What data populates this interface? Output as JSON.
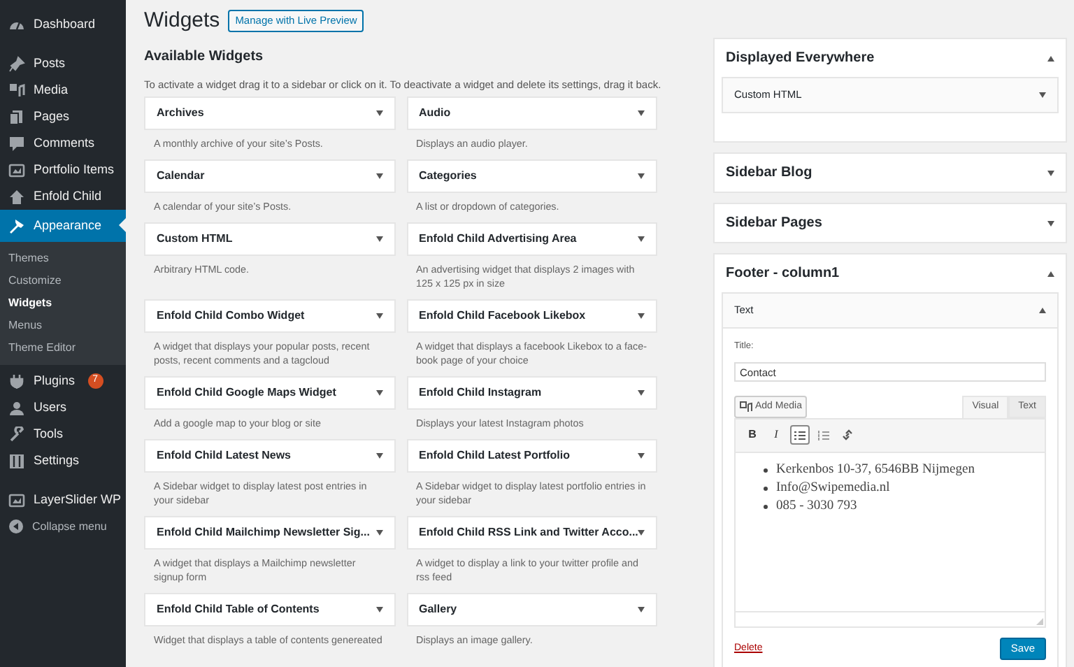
{
  "sidebar": {
    "groups": [
      [
        {
          "label": "Dashboard",
          "selected": false
        }
      ],
      [
        {
          "label": "Posts",
          "selected": false
        },
        {
          "label": "Media",
          "selected": false
        },
        {
          "label": "Pages",
          "selected": false
        },
        {
          "label": "Comments",
          "selected": false
        },
        {
          "label": "Portfolio Items",
          "selected": false
        },
        {
          "label": "Enfold Child",
          "selected": false
        },
        {
          "label": "Appearance",
          "selected": true,
          "children": [
            {
              "label": "Themes",
              "selected": false
            },
            {
              "label": "Customize",
              "selected": false
            },
            {
              "label": "Widgets",
              "selected": true
            },
            {
              "label": "Menus",
              "selected": false
            },
            {
              "label": "Theme Editor",
              "selected": false
            }
          ]
        },
        {
          "label": "Plugins",
          "selected": false,
          "badge": "7"
        },
        {
          "label": "Users",
          "selected": false
        },
        {
          "label": "Tools",
          "selected": false
        },
        {
          "label": "Settings",
          "selected": false
        }
      ],
      [
        {
          "label": "LayerSlider WP",
          "selected": false
        }
      ]
    ],
    "collapse": "Collapse menu"
  },
  "header": {
    "title": "Widgets",
    "button": "Manage with Live Preview"
  },
  "available": {
    "title": "Available Widgets",
    "description": "To activate a widget drag it to a sidebar or click on it. To deactivate a widget and delete its settings, drag it back.",
    "widgets": [
      {
        "title": "Archives",
        "description": "A monthly archive of your site’s Posts."
      },
      {
        "title": "Audio",
        "description": "Displays an audio player."
      },
      {
        "title": "Calendar",
        "description": "A calendar of your site’s Posts."
      },
      {
        "title": "Categories",
        "description": "A list or dropdown of categories."
      },
      {
        "title": "Custom HTML",
        "description": "Arbitrary HTML code."
      },
      {
        "title": "Enfold Child Advertising Area",
        "description": "An advertising widget that displays 2 images with 125 x 125 px in size"
      },
      {
        "title": "Enfold Child Combo Widget",
        "description": "A widget that displays your popular posts, recent posts, recent comments and a tagcloud"
      },
      {
        "title": "Enfold Child Facebook Likebox",
        "description": "A widget that displays a facebook Likebox to a face-book page of your choice"
      },
      {
        "title": "Enfold Child Google Maps Widget",
        "description": "Add a google map to your blog or site"
      },
      {
        "title": "Enfold Child Instagram",
        "description": "Displays your latest Instagram photos"
      },
      {
        "title": "Enfold Child Latest News",
        "description": "A Sidebar widget to display latest post entries in your sidebar"
      },
      {
        "title": "Enfold Child Latest Portfolio",
        "description": "A Sidebar widget to display latest portfolio entries in your sidebar"
      },
      {
        "title": "Enfold Child Mailchimp Newsletter Sig...",
        "description": "A widget that displays a Mailchimp newsletter signup form"
      },
      {
        "title": "Enfold Child RSS Link and Twitter Acco...",
        "description": "A widget to display a link to your twitter profile and rss feed"
      },
      {
        "title": "Enfold Child Table of Contents",
        "description": "Widget that displays a table of contents genereated"
      },
      {
        "title": "Gallery",
        "description": "Displays an image gallery."
      }
    ]
  },
  "areas": [
    {
      "title": "Displayed Everywhere",
      "expanded": true,
      "widgets": [
        {
          "title": "Custom HTML",
          "expanded": false
        }
      ]
    },
    {
      "title": "Sidebar Blog",
      "expanded": false
    },
    {
      "title": "Sidebar Pages",
      "expanded": false
    },
    {
      "title": "Footer - column1",
      "expanded": true,
      "widgets": [
        {
          "title": "Text",
          "expanded": true,
          "form": {
            "title_label": "Title:",
            "title_value": "Contact",
            "add_media": "Add Media",
            "tabs": [
              {
                "label": "Visual",
                "selected": true
              },
              {
                "label": "Text",
                "selected": false
              }
            ],
            "toolbar": [
              {
                "kind": "bold",
                "label": "B",
                "selected": false
              },
              {
                "kind": "italic",
                "label": "I",
                "selected": false
              },
              {
                "kind": "bullets",
                "selected": true
              },
              {
                "kind": "numbers",
                "selected": false
              },
              {
                "kind": "link",
                "selected": false
              }
            ],
            "content": [
              "Kerkenbos 10-37, 6546BB Nijmegen",
              "Info@Swipemedia.nl",
              "085 - 3030 793"
            ],
            "delete": "Delete",
            "save": "Save"
          }
        }
      ]
    }
  ]
}
